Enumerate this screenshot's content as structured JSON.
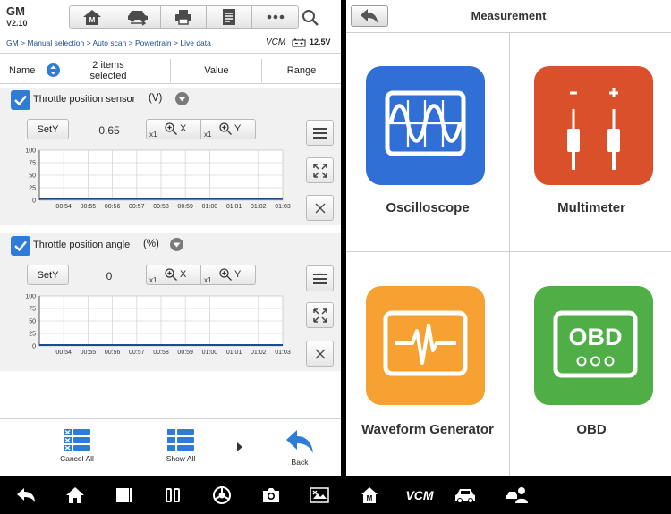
{
  "left_app": {
    "brand": {
      "make": "GM",
      "version": "V2.10"
    },
    "breadcrumb": [
      "GM",
      "Manual selection",
      "Auto scan",
      "Powertrain",
      "Live data"
    ],
    "breadcrumb_sep": ">",
    "status": {
      "module": "VCM",
      "voltage": "12.5V"
    },
    "columns": {
      "name": "Name",
      "items_selected": "2 items selected",
      "value": "Value",
      "range": "Range"
    },
    "sensors": [
      {
        "name": "Throttle position sensor",
        "unit": "(V)",
        "value": "0.65",
        "checked": true,
        "sety_label": "SetY",
        "zoom_x": {
          "prefix": "x1",
          "axis": "X"
        },
        "zoom_y": {
          "prefix": "x1",
          "axis": "Y"
        },
        "y_ticks": [
          "100",
          "75",
          "50",
          "25",
          "0"
        ],
        "x_ticks": [
          "00:54",
          "00:55",
          "00:56",
          "00:57",
          "00:58",
          "00:59",
          "01:00",
          "01:01",
          "01:02",
          "01:03"
        ]
      },
      {
        "name": "Throttle position angle",
        "unit": "(%)",
        "value": "0",
        "checked": true,
        "sety_label": "SetY",
        "zoom_x": {
          "prefix": "x1",
          "axis": "X"
        },
        "zoom_y": {
          "prefix": "x1",
          "axis": "Y"
        },
        "y_ticks": [
          "100",
          "75",
          "50",
          "25",
          "0"
        ],
        "x_ticks": [
          "00:54",
          "00:55",
          "00:56",
          "00:57",
          "00:58",
          "00:59",
          "01:00",
          "01:01",
          "01:02",
          "01:03"
        ]
      }
    ],
    "bottom": {
      "cancel_all": "Cancel All",
      "show_all": "Show All",
      "back": "Back"
    }
  },
  "right_app": {
    "title": "Measurement",
    "tiles": [
      {
        "label": "Oscilloscope",
        "color": "#2f6fd6",
        "icon": "oscilloscope-icon"
      },
      {
        "label": "Multimeter",
        "color": "#d9502a",
        "icon": "multimeter-icon"
      },
      {
        "label": "Waveform Generator",
        "color": "#f6a132",
        "icon": "waveform-icon"
      },
      {
        "label": "OBD",
        "color": "#4fae45",
        "icon": "obd-icon",
        "text": "OBD"
      }
    ]
  },
  "navbar": {
    "vcm": "VCM"
  },
  "colors": {
    "accent_blue": "#2f7cd8",
    "crumb": "#1d4b8f",
    "trace": "#1d4b8f"
  }
}
